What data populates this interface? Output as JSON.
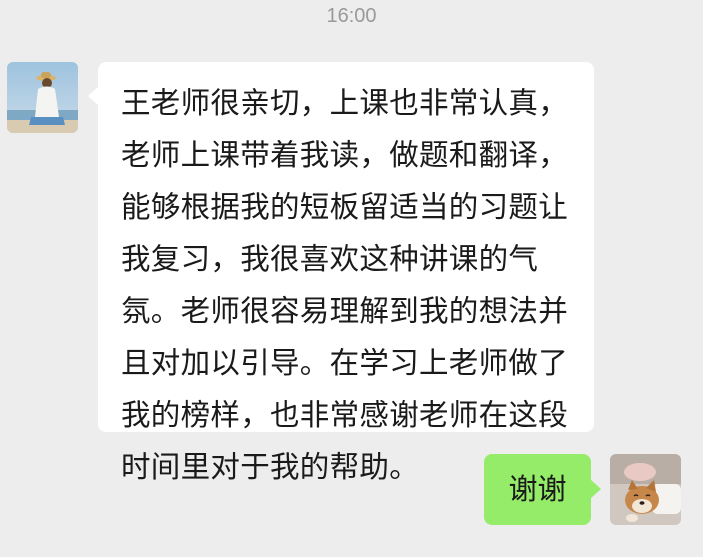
{
  "timestamp": "16:00",
  "messages": {
    "incoming": {
      "sender_avatar": "avatar-girl-by-sea",
      "lines": [
        "王老师很亲切，上课也非常认真，",
        "老师上课带着我读，做题和翻译，",
        "能够根据我的短板留适当的习题让",
        "我复习，我很喜欢这种讲课的气",
        "氛。老师很容易理解到我的想法并",
        "且对加以引导。在学习上老师做了",
        "我的榜样，也非常感谢老师在这段",
        "时间里对于我的帮助。"
      ]
    },
    "outgoing": {
      "sender_avatar": "avatar-shiba-dog",
      "text": "谢谢"
    }
  },
  "colors": {
    "background": "#ededed",
    "incoming_bubble": "#ffffff",
    "outgoing_bubble": "#95ec69",
    "timestamp": "#9a9a9a"
  }
}
